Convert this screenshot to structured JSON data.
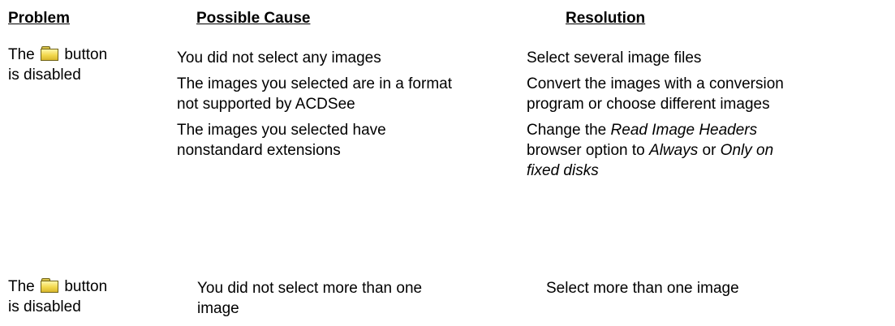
{
  "headers": {
    "problem": "Problem",
    "cause": "Possible Cause",
    "resolution": "Resolution"
  },
  "rows": [
    {
      "problem": {
        "before": "The",
        "icon": "folder-icon",
        "after": "button",
        "line2": "is disabled"
      },
      "causes": [
        "You did not select any images",
        "The images you selected are in a format not supported by ACDSee",
        "The images you selected have nonstandard extensions"
      ],
      "resolutions": {
        "r1": "Select several image files",
        "r2": "Convert the images with a conversion program or choose different images",
        "r3": {
          "t1": "Change the ",
          "i1": "Read Image Headers",
          "t2": " browser option to ",
          "i2": "Always",
          "t3": " or ",
          "i3": "Only on fixed disks"
        }
      }
    },
    {
      "problem": {
        "before": "The",
        "icon": "folder-icon",
        "after": "button",
        "line2": "is disabled"
      },
      "cause": "You did not select more than one image",
      "resolution": "Select more than one image"
    }
  ]
}
